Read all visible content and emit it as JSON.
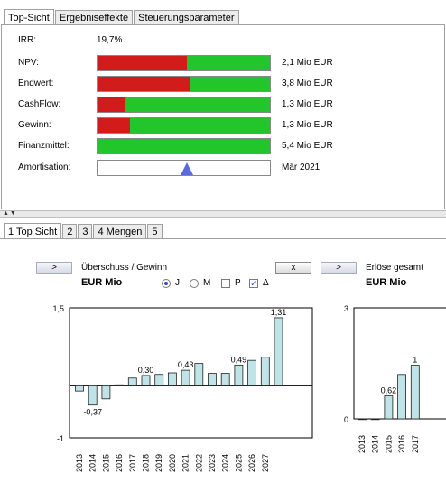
{
  "top_tabs": [
    "Top-Sicht",
    "Ergebniseffekte",
    "Steuerungsparameter"
  ],
  "kpis": {
    "irr": {
      "label": "IRR:",
      "value": "19,7%"
    },
    "rows": [
      {
        "label": "NPV:",
        "value": "2,1 Mio EUR",
        "red_fraction": 0.52
      },
      {
        "label": "Endwert:",
        "value": "3,8 Mio EUR",
        "red_fraction": 0.54
      },
      {
        "label": "CashFlow:",
        "value": "1,3 Mio EUR",
        "red_fraction": 0.16
      },
      {
        "label": "Gewinn:",
        "value": "1,3 Mio EUR",
        "red_fraction": 0.19
      },
      {
        "label": "Finanzmittel:",
        "value": "5,4 Mio EUR",
        "red_fraction": 0.0
      }
    ],
    "amortisation": {
      "label": "Amortisation:",
      "value": "Mär 2021",
      "marker_fraction": 0.52
    }
  },
  "colors": {
    "bar_red": "#d21b1b",
    "bar_green": "#22c62a",
    "marker": "#5a6cd8",
    "chart_bar": "#bfe3e6"
  },
  "bottom_tabs": [
    "1 Top Sicht",
    "2",
    "3",
    "4 Mengen",
    "5"
  ],
  "chart1": {
    "expand_label": ">",
    "title": "Überschuss / Gewinn",
    "unit": "EUR Mio",
    "options": [
      {
        "label": "J",
        "kind": "radio",
        "checked": true
      },
      {
        "label": "M",
        "kind": "radio",
        "checked": false
      },
      {
        "label": "P",
        "kind": "checkbox",
        "checked": false
      },
      {
        "label": "Δ",
        "kind": "checkbox",
        "checked": true
      }
    ],
    "close_label": "x"
  },
  "chart2": {
    "expand_label": ">",
    "title": "Erlöse gesamt",
    "unit": "EUR Mio"
  },
  "chart_data": [
    {
      "type": "bar",
      "ylim": [
        -1,
        1.5
      ],
      "y_tick_labels": [
        "1,5",
        "-1"
      ],
      "categories": [
        "2013",
        "2014",
        "2015",
        "2016",
        "2017",
        "2018",
        "2019",
        "2020",
        "2021",
        "2022",
        "2023",
        "2024",
        "2025",
        "2026",
        "2027"
      ],
      "values": [
        -0.1,
        -0.37,
        -0.25,
        0.02,
        0.15,
        0.2,
        0.22,
        0.25,
        0.3,
        0.43,
        0.24,
        0.24,
        0.4,
        0.49,
        0.55,
        1.31
      ],
      "value_labels": [
        {
          "index": 1,
          "text": "-0,37"
        },
        {
          "index": 5,
          "text": "0,30"
        },
        {
          "index": 8,
          "text": "0,43"
        },
        {
          "index": 12,
          "text": "0,49"
        },
        {
          "index": 15,
          "text": "1,31"
        }
      ]
    },
    {
      "type": "bar",
      "ylim": [
        0,
        3
      ],
      "y_tick_labels": [
        "3",
        "0"
      ],
      "categories": [
        "2013",
        "2014",
        "2015",
        "2016",
        "2017"
      ],
      "values": [
        0.0,
        0.0,
        0.62,
        1.2,
        1.45
      ],
      "value_labels": [
        {
          "index": 2,
          "text": "0,62"
        },
        {
          "index": 4,
          "text": "1"
        }
      ]
    }
  ]
}
